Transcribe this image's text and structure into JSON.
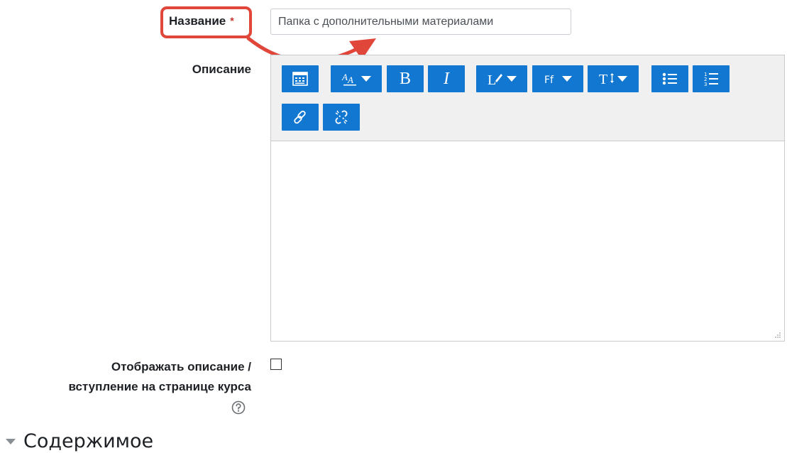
{
  "form": {
    "name_label": "Название",
    "required_marker": "*",
    "name_value": "Папка с дополнительными материалами",
    "description_label": "Описание",
    "show_description_label_line1": "Отображать описание /",
    "show_description_label_line2": "вступление на странице курса",
    "show_description_checked": false
  },
  "toolbar": {
    "buttons": [
      {
        "name": "show-more-buttons",
        "icon": "toolbar-toggle-icon"
      },
      {
        "name": "font-style",
        "icon": "font-style-icon",
        "dropdown": true
      },
      {
        "name": "bold",
        "icon": "bold-icon",
        "glyph": "B"
      },
      {
        "name": "italic",
        "icon": "italic-icon",
        "glyph": "I"
      },
      {
        "name": "styles",
        "icon": "paragraph-style-icon",
        "dropdown": true
      },
      {
        "name": "font-family",
        "icon": "font-family-icon",
        "dropdown": true
      },
      {
        "name": "font-size",
        "icon": "font-size-icon",
        "dropdown": true
      },
      {
        "name": "unordered-list",
        "icon": "bullet-list-icon"
      },
      {
        "name": "ordered-list",
        "icon": "numbered-list-icon"
      },
      {
        "name": "link",
        "icon": "link-icon"
      },
      {
        "name": "unlink",
        "icon": "unlink-icon"
      }
    ]
  },
  "section": {
    "title": "Содержимое"
  },
  "colors": {
    "accent": "#1177d1",
    "highlight": "#e0463a",
    "required": "#c9302c",
    "toolbar_bg": "#f0f0f0"
  }
}
